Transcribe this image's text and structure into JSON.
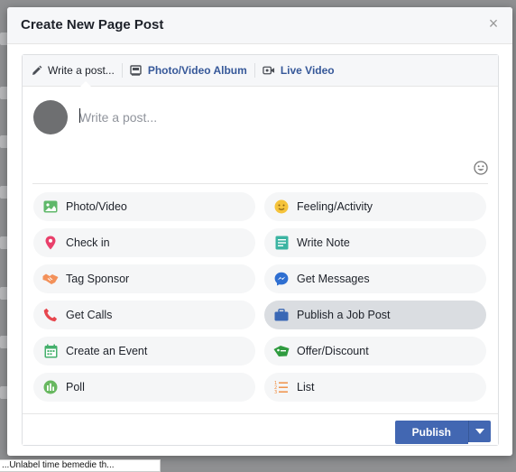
{
  "modal": {
    "title": "Create New Page Post",
    "close_label": "×"
  },
  "tabs": [
    {
      "label": "Write a post...",
      "icon": "pencil-icon",
      "active": true
    },
    {
      "label": "Photo/Video Album",
      "icon": "album-icon",
      "active": false
    },
    {
      "label": "Live Video",
      "icon": "live-video-icon",
      "active": false
    }
  ],
  "composer": {
    "placeholder": "Write a post..."
  },
  "options": [
    {
      "label": "Photo/Video",
      "icon": "photo-icon",
      "color": "#5fb86a"
    },
    {
      "label": "Feeling/Activity",
      "icon": "smiley-icon",
      "color": "#f5c33b"
    },
    {
      "label": "Check in",
      "icon": "location-pin-icon",
      "color": "#e9406b"
    },
    {
      "label": "Write Note",
      "icon": "note-icon",
      "color": "#3bb4a2"
    },
    {
      "label": "Tag Sponsor",
      "icon": "handshake-icon",
      "color": "#f3915a"
    },
    {
      "label": "Get Messages",
      "icon": "messenger-icon",
      "color": "#2f6fd1"
    },
    {
      "label": "Get Calls",
      "icon": "phone-icon",
      "color": "#e7474e"
    },
    {
      "label": "Publish a Job Post",
      "icon": "briefcase-icon",
      "color": "#3a68b5",
      "selected": true
    },
    {
      "label": "Create an Event",
      "icon": "calendar-icon",
      "color": "#45b06c"
    },
    {
      "label": "Offer/Discount",
      "icon": "offer-tag-icon",
      "color": "#2f9b3f"
    },
    {
      "label": "Poll",
      "icon": "poll-icon",
      "color": "#68b860"
    },
    {
      "label": "List",
      "icon": "numbered-list-icon",
      "color": "#f08a3b"
    }
  ],
  "footer": {
    "publish_label": "Publish"
  },
  "tooltip": {
    "text": "...Unlabel time bemedie th..."
  },
  "colors": {
    "brand_blue": "#4267b2",
    "link_blue": "#365899"
  }
}
